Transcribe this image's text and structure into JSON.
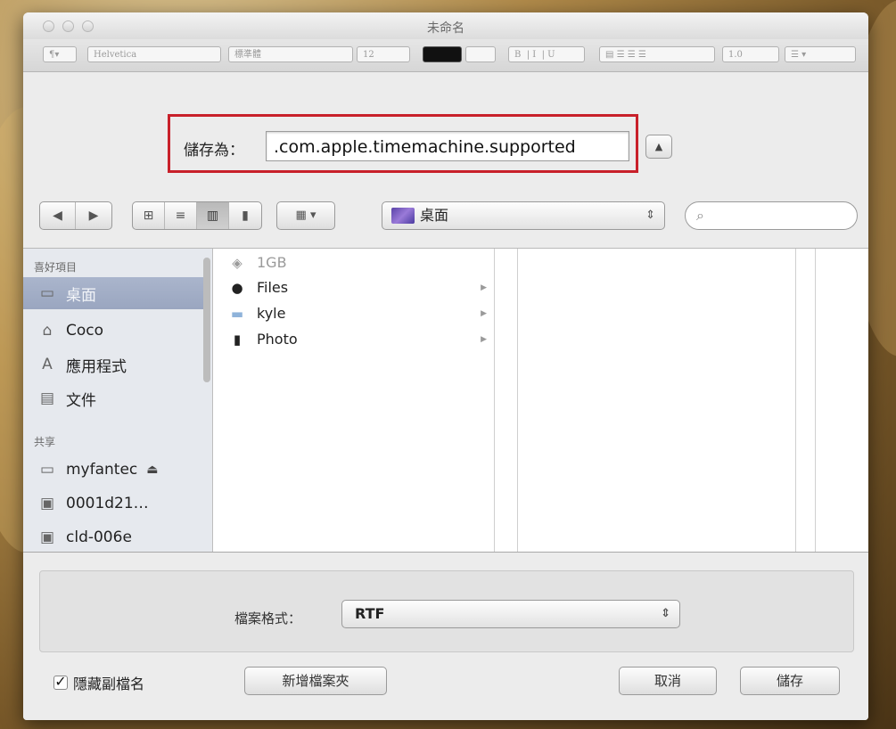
{
  "window": {
    "title": "未命名"
  },
  "toolbar": {
    "paragraph": "¶▾",
    "font": "Helvetica",
    "style": "標準體",
    "size": "12",
    "bold": "B",
    "italic": "I",
    "underline": "U",
    "spacing": "1.0"
  },
  "save_as": {
    "label": "儲存為：",
    "value": ".com.apple.timemachine.supported"
  },
  "nav": {
    "location": "桌面",
    "search_placeholder": ""
  },
  "sidebar": {
    "favorites_header": "喜好項目",
    "favorites": [
      {
        "label": "桌面",
        "icon": "desktop-icon"
      },
      {
        "label": "Coco",
        "icon": "home-icon"
      },
      {
        "label": "應用程式",
        "icon": "applications-icon"
      },
      {
        "label": "文件",
        "icon": "documents-icon"
      }
    ],
    "shared_header": "共享",
    "shared": [
      {
        "label": "myfantec",
        "icon": "display-icon"
      },
      {
        "label": "0001d21…",
        "icon": "server-icon"
      },
      {
        "label": "cld-006e",
        "icon": "server-icon"
      }
    ]
  },
  "files": [
    {
      "name": "1GB",
      "icon": "drive-icon",
      "dim": true
    },
    {
      "name": "Files",
      "icon": "app-icon",
      "has_children": true
    },
    {
      "name": "kyle",
      "icon": "folder-icon",
      "has_children": true
    },
    {
      "name": "Photo",
      "icon": "trash-icon",
      "has_children": true
    }
  ],
  "format": {
    "label": "檔案格式：",
    "value": "RTF"
  },
  "footer": {
    "hide_extension": "隱藏副檔名",
    "hide_extension_checked": true,
    "new_folder": "新增檔案夾",
    "cancel": "取消",
    "save": "儲存"
  }
}
